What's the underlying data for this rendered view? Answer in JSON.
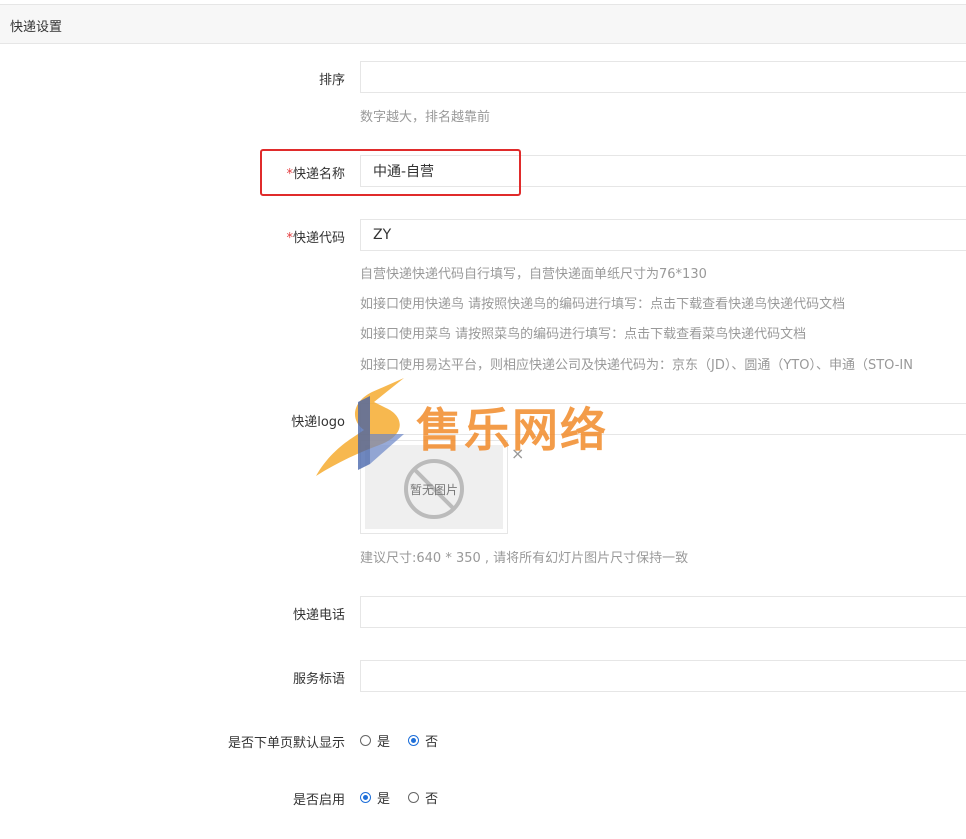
{
  "panel": {
    "title": "快递设置"
  },
  "form": {
    "sort": {
      "label": "排序",
      "value": "",
      "hint": "数字越大，排名越靠前"
    },
    "name": {
      "required_mark": "*",
      "label": "快递名称",
      "value": "中通-自营"
    },
    "code": {
      "required_mark": "*",
      "label": "快递代码",
      "value": "ZY",
      "hints": [
        "自营快递快递代码自行填写，自营快递面单纸尺寸为76*130",
        "如接口使用快递鸟 请按照快递鸟的编码进行填写：点击下载查看快递鸟快递代码文档",
        "如接口使用菜鸟 请按照菜鸟的编码进行填写：点击下载查看菜鸟快递代码文档",
        "如接口使用易达平台，则相应快递公司及快递代码为：京东（JD）、圆通（YTO）、申通（STO-IN"
      ]
    },
    "logo": {
      "label": "快递logo",
      "value": "",
      "placeholder_text": "暂无图片",
      "close_glyph": "×",
      "hint": "建议尺寸:640 * 350 , 请将所有幻灯片图片尺寸保持一致"
    },
    "phone": {
      "label": "快递电话",
      "value": ""
    },
    "slogan": {
      "label": "服务标语",
      "value": ""
    },
    "default_show": {
      "label": "是否下单页默认显示",
      "options": [
        {
          "label": "是",
          "checked": false
        },
        {
          "label": "否",
          "checked": true
        }
      ]
    },
    "enabled": {
      "label": "是否启用",
      "options": [
        {
          "label": "是",
          "checked": true
        },
        {
          "label": "否",
          "checked": false
        }
      ]
    }
  },
  "watermark": {
    "text": "售乐网络"
  },
  "colors": {
    "highlight": "#e02b2b",
    "radio_checked": "#1e6fd9",
    "required": "#e4393c",
    "watermark": "#f28b2a"
  }
}
